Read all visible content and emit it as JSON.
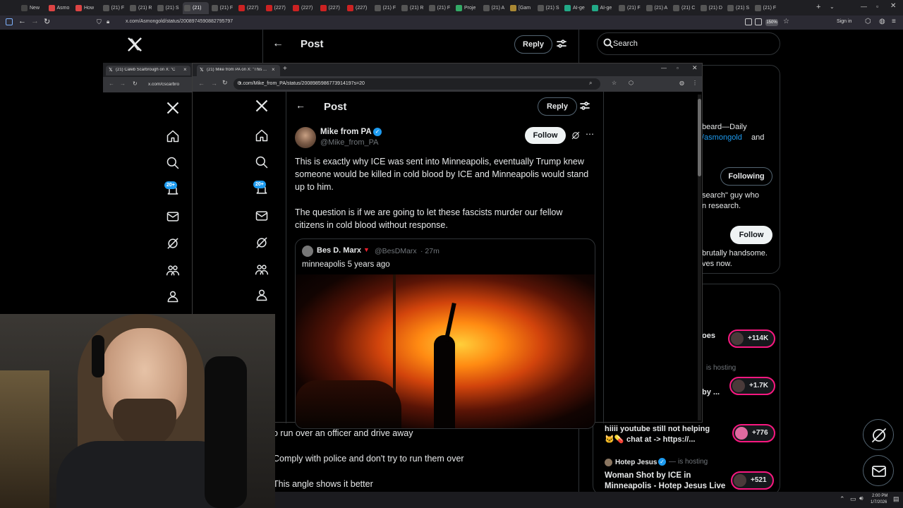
{
  "browser": {
    "tabs": [
      "New",
      "Asmo",
      "How",
      "(21) F",
      "(21) R",
      "(21) S",
      "(21)",
      "(21) F",
      "(227)",
      "(227)",
      "(227)",
      "(227)",
      "(227)",
      "(21) F",
      "(21) R",
      "(21) F",
      "Proje",
      "(21) A",
      "[Gam",
      "(21) S",
      "AI-ge",
      "AI-ge",
      "(21) F",
      "(21) A",
      "(21) C",
      "(21) D",
      "(21) S",
      "(21) F"
    ],
    "url": "x.com/Asmongold/status/2008974590882795797",
    "zoom": "150%",
    "signin": "Sign in"
  },
  "bg_page": {
    "header_title": "Post",
    "reply_label": "Reply",
    "search_placeholder": "Search",
    "who_text_1": "beard—Daily",
    "who_link": "/asmongold",
    "who_text_and": "and",
    "following_label": "Following",
    "who_text_2": "search\" guy who",
    "who_text_3": "n research.",
    "follow_label": "Follow",
    "who_text_4": "brutally handsome.",
    "who_text_5": "ves now.",
    "live_text_1": "oes",
    "live_hosting_1": "is hosting",
    "live_text_2": "by ...",
    "live_title_3a": "hiiii youtube still not helping",
    "live_title_3b": "chat at -> https://...",
    "live_host_name": "Hotep Jesus",
    "live_hosting_4": "is hosting",
    "live_title_4a": "Woman Shot by ICE in",
    "live_title_4b": "Minneapolis - Hotep Jesus Live",
    "live_counts": [
      "+114K",
      "+1.7K",
      "+776",
      "+521"
    ],
    "below_lines": [
      "o run over an officer and drive away",
      "Comply with police and don't try to run them over",
      "This angle shows it better"
    ]
  },
  "win2": {
    "tab_title": "(21) Caleb Scarbrough on X: \"C",
    "url": "x.com/cscarbro"
  },
  "win1": {
    "tab_title": "(21) Mike from PA on X: \"This ...",
    "url": "x.com/Mike_from_PA/status/2008985986773914197s=20",
    "header_title": "Post",
    "reply_label": "Reply",
    "notif_badge": "20+",
    "author_name": "Mike from PA",
    "author_handle": "@Mike_from_PA",
    "follow_label": "Follow",
    "tweet_p1": "This is exactly why ICE was sent into Minneapolis, eventually Trump knew someone would be killed in cold blood by ICE and Minneapolis would stand up to him.",
    "tweet_p2": "The question is if we are going to let these fascists murder our fellow citizens in cold blood without response.",
    "quote_name": "Bes D. Marx",
    "quote_handle": "@BesDMarx",
    "quote_time": "· 27m",
    "quote_text": "minneapolis 5 years ago"
  },
  "bg_badge": "20+",
  "taskbar": {
    "time": "2:00 PM",
    "date": "1/7/2026"
  },
  "colors": {
    "accent": "#1d9bf0",
    "live_border": "#f91880",
    "background": "#000000"
  }
}
